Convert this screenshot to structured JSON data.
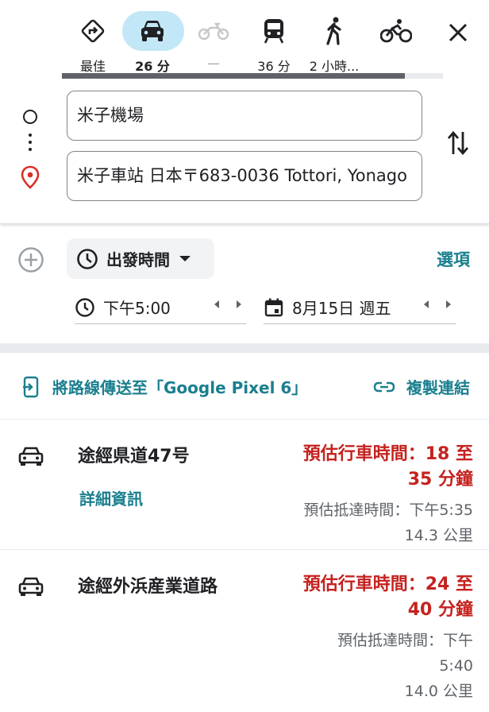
{
  "modes": [
    {
      "name": "best",
      "label": "最佳"
    },
    {
      "name": "drive",
      "label": "26 分"
    },
    {
      "name": "motorcycle",
      "label": "—"
    },
    {
      "name": "transit",
      "label": "36 分"
    },
    {
      "name": "walk",
      "label": "2 小時..."
    },
    {
      "name": "bicycle",
      "label": ""
    }
  ],
  "route": {
    "origin": "米子機場",
    "destination": "米子車站 日本〒683-0036 Tottori, Yonago"
  },
  "time": {
    "depart_label": "出發時間",
    "options_label": "選項",
    "time_value": "下午5:00",
    "date_value": "8月15日 週五"
  },
  "actions": {
    "send_label": "將路線傳送至「Google Pixel 6」",
    "copy_label": "複製連結"
  },
  "routes": [
    {
      "name": "途經県道47号",
      "details": "詳細資訊",
      "time_line1": "預估行車時間：18 至",
      "time_line2": "35 分鐘",
      "arrive": "預估抵達時間：下午5:35",
      "distance": "14.3 公里"
    },
    {
      "name": "途經外浜産業道路",
      "time_line1": "預估行車時間：24 至",
      "time_line2": "40 分鐘",
      "arrive_line1": "預估抵達時間：下午",
      "arrive_line2": "5:40",
      "distance": "14.0 公里"
    }
  ],
  "colors": {
    "accent": "#1a7f8f",
    "selected_pill": "#c2e7f7",
    "duration_red": "#c5221f",
    "pin_red": "#d93025"
  }
}
